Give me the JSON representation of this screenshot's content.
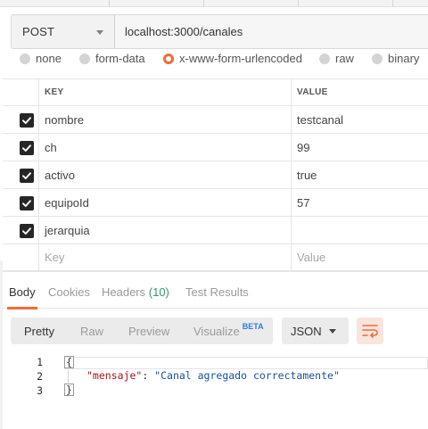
{
  "request": {
    "method": "POST",
    "url": "localhost:3000/canales"
  },
  "body_types": [
    {
      "label": "none",
      "selected": false
    },
    {
      "label": "form-data",
      "selected": false
    },
    {
      "label": "x-www-form-urlencoded",
      "selected": true
    },
    {
      "label": "raw",
      "selected": false
    },
    {
      "label": "binary",
      "selected": false
    }
  ],
  "params_table": {
    "headers": {
      "key": "KEY",
      "value": "VALUE"
    },
    "rows": [
      {
        "key": "nombre",
        "value": "testcanal",
        "checked": true
      },
      {
        "key": "ch",
        "value": "99",
        "checked": true
      },
      {
        "key": "activo",
        "value": "true",
        "checked": true
      },
      {
        "key": "equipoId",
        "value": "57",
        "checked": true
      },
      {
        "key": "jerarquia",
        "value": "",
        "checked": true
      }
    ],
    "new_row": {
      "key_placeholder": "Key",
      "value_placeholder": "Value"
    }
  },
  "response_tabs": {
    "body": "Body",
    "cookies": "Cookies",
    "headers": "Headers",
    "headers_count": "(10)",
    "test_results": "Test Results",
    "active": "Body"
  },
  "format_toolbar": {
    "pretty": "Pretty",
    "raw": "Raw",
    "preview": "Preview",
    "visualize": "Visualize",
    "visualize_badge": "BETA",
    "active": "Pretty",
    "language": "JSON"
  },
  "response_body": {
    "line_numbers": [
      "1",
      "2",
      "3"
    ],
    "open_brace": "{",
    "key": "\"mensaje\"",
    "colon": ": ",
    "value": "\"Canal agregado correctamente\"",
    "close_brace": "}"
  },
  "colors": {
    "accent": "#f26b3a",
    "count_green": "#2e9b63",
    "beta_blue": "#2f7dd1"
  }
}
